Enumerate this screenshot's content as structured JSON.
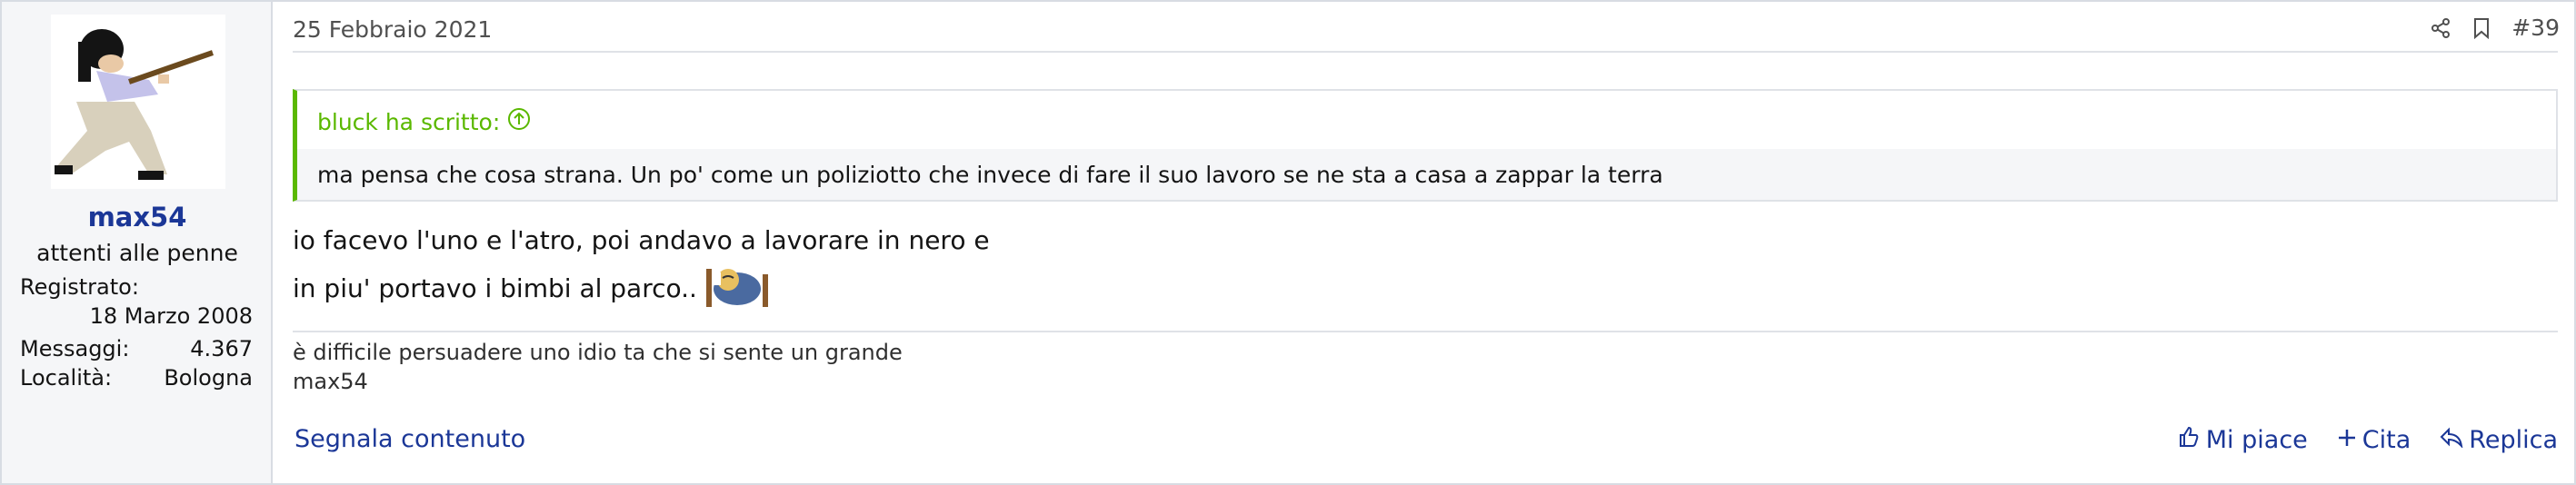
{
  "user": {
    "name": "max54",
    "title": "attenti alle penne",
    "extras": [
      {
        "label": "Registrato:",
        "value": "18 Marzo 2008"
      },
      {
        "label": "Messaggi:",
        "value": "4.367"
      },
      {
        "label": "Località:",
        "value": "Bologna"
      }
    ]
  },
  "post": {
    "date": "25 Febbraio 2021",
    "number": "#39",
    "icons": [
      "share-icon",
      "bookmark-icon"
    ],
    "quote": {
      "author_line": "bluck ha scritto:",
      "text": "ma pensa che cosa strana. Un po' come un poliziotto che invece di fare il suo lavoro se ne sta a casa a zappar la terra"
    },
    "message_lines": [
      "io facevo l'uno e l'atro, poi andavo a lavorare in nero e",
      "in piu' portavo i bimbi al parco.."
    ],
    "signature_lines": [
      "è difficile persuadere uno idio ta che si sente un grande",
      "max54"
    ],
    "report_label": "Segnala contenuto",
    "actions": {
      "like": "Mi piace",
      "quote": "Cita",
      "reply": "Replica"
    }
  },
  "colors": {
    "link": "#1b3797",
    "quote_accent": "#5ab800",
    "border": "#d8dce3"
  }
}
